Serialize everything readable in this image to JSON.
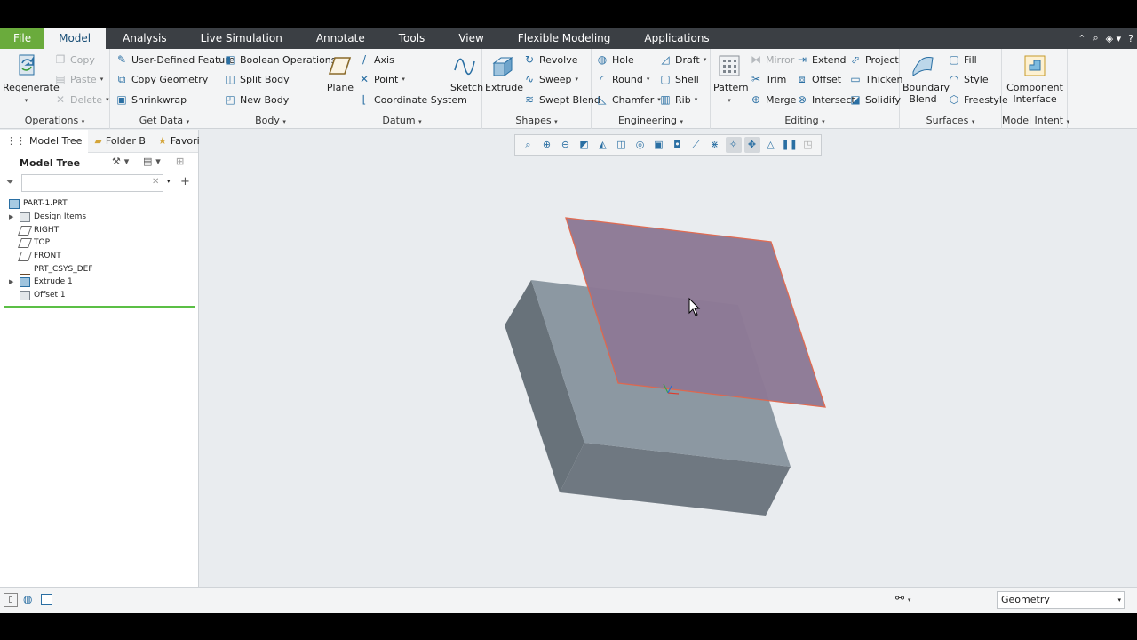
{
  "tabs": {
    "file": "File",
    "model": "Model",
    "analysis": "Analysis",
    "live_simulation": "Live Simulation",
    "annotate": "Annotate",
    "tools": "Tools",
    "view": "View",
    "flexible_modeling": "Flexible Modeling",
    "applications": "Applications"
  },
  "ribbon": {
    "operations": {
      "regenerate": "Regenerate",
      "copy": "Copy",
      "paste": "Paste",
      "delete": "Delete",
      "label": "Operations"
    },
    "get_data": {
      "user_defined_feature": "User-Defined Feature",
      "copy_geometry": "Copy Geometry",
      "shrinkwrap": "Shrinkwrap",
      "label": "Get Data"
    },
    "body": {
      "boolean_operations": "Boolean Operations",
      "split_body": "Split Body",
      "new_body": "New Body",
      "label": "Body"
    },
    "datum": {
      "plane": "Plane",
      "axis": "Axis",
      "point": "Point",
      "coordinate_system": "Coordinate System",
      "sketch": "Sketch",
      "label": "Datum"
    },
    "shapes": {
      "extrude": "Extrude",
      "revolve": "Revolve",
      "sweep": "Sweep",
      "swept_blend": "Swept Blend",
      "label": "Shapes"
    },
    "engineering": {
      "hole": "Hole",
      "draft": "Draft",
      "round": "Round",
      "shell": "Shell",
      "chamfer": "Chamfer",
      "rib": "Rib",
      "label": "Engineering"
    },
    "editing": {
      "pattern": "Pattern",
      "mirror": "Mirror",
      "extend": "Extend",
      "project": "Project",
      "trim": "Trim",
      "offset": "Offset",
      "thicken": "Thicken",
      "merge": "Merge",
      "intersect": "Intersect",
      "solidify": "Solidify",
      "label": "Editing"
    },
    "surfaces": {
      "boundary_blend": "Boundary Blend",
      "fill": "Fill",
      "style": "Style",
      "freestyle": "Freestyle",
      "label": "Surfaces"
    },
    "model_intent": {
      "component_interface": "Component Interface",
      "label": "Model Intent"
    }
  },
  "left_panel": {
    "tabs": {
      "model_tree": "Model Tree",
      "folder_browser": "Folder B",
      "favorites": "Favorites"
    },
    "header": "Model Tree",
    "search_value": "",
    "tree": [
      "PART-1.PRT",
      "Design Items",
      "RIGHT",
      "TOP",
      "FRONT",
      "PRT_CSYS_DEF",
      "Extrude 1",
      "Offset 1"
    ]
  },
  "status": {
    "filter_value": "Geometry"
  },
  "colors": {
    "file_tab": "#6aab3c",
    "tabbar": "#3b3f44",
    "surface": "#8e7a96",
    "surface_edge": "#e0674d",
    "block_top": "#8c98a2",
    "block_side": "#68727a"
  }
}
